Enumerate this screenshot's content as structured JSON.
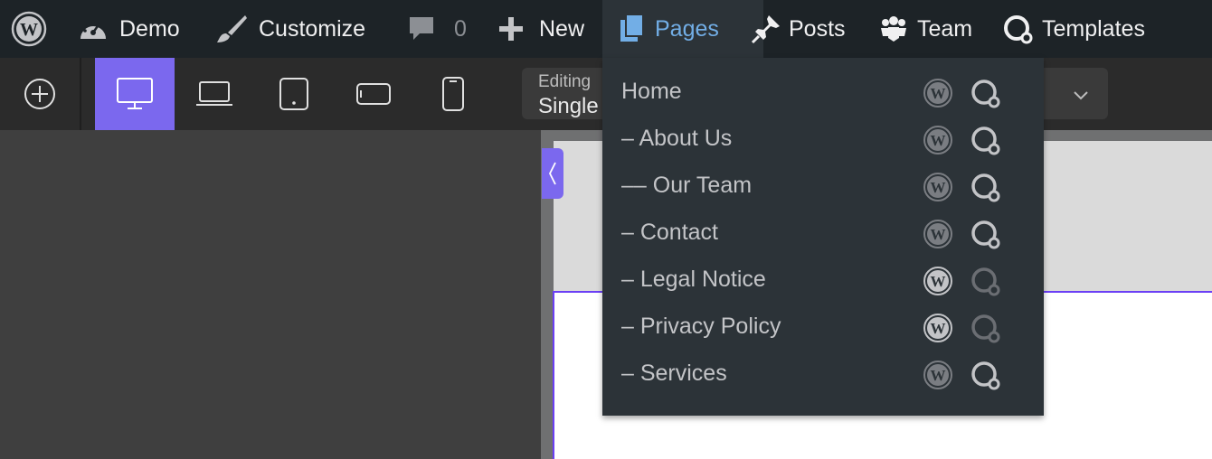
{
  "admin_bar": {
    "site_name": "Demo",
    "customize": "Customize",
    "comments_count": "0",
    "new_label": "New",
    "pages_label": "Pages",
    "posts_label": "Posts",
    "team_label": "Team",
    "templates_label": "Templates"
  },
  "toolbar": {
    "editing_label": "Editing",
    "editing_value": "Single",
    "active_device": "desktop"
  },
  "pages_menu": {
    "items": [
      {
        "label": "Home"
      },
      {
        "label": "– About Us"
      },
      {
        "label": "–– Our Team"
      },
      {
        "label": "– Contact"
      },
      {
        "label": "– Legal Notice"
      },
      {
        "label": "– Privacy Policy"
      },
      {
        "label": "– Services"
      }
    ]
  },
  "colors": {
    "admin_bar_bg": "#1d2327",
    "pages_active": "#72aee6",
    "accent": "#7b68ee"
  }
}
